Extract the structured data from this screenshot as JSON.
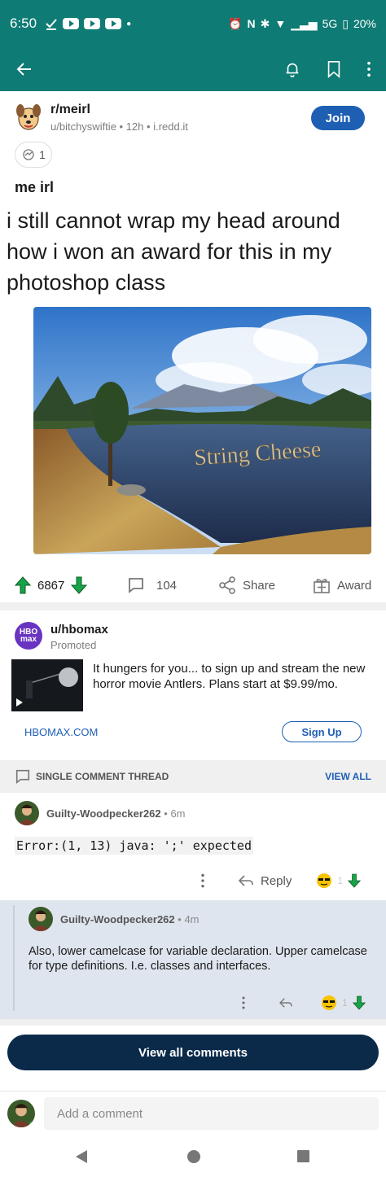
{
  "status_bar": {
    "time": "6:50",
    "network": "5G",
    "battery": "20%"
  },
  "toolbar": {
    "back_icon": "arrow-left-icon",
    "notification_icon": "bell-icon",
    "save_icon": "bookmark-icon",
    "more_icon": "more-vertical-icon"
  },
  "post": {
    "subreddit": "r/meirl",
    "author": "u/bitchyswiftie",
    "age": "12h",
    "domain": "i.redd.it",
    "join_label": "Join",
    "award_count": "1",
    "flair": "me irl",
    "title": "i still cannot wrap my head around how i won an award for this in my photoshop class",
    "image_caption": "String Cheese",
    "upvotes": "6867",
    "comments": "104",
    "share_label": "Share",
    "award_label": "Award"
  },
  "ad": {
    "user": "u/hbomax",
    "logo_text_1": "HBO",
    "logo_text_2": "max",
    "promoted_label": "Promoted",
    "text": "It hungers for you... to sign up and stream the new horror movie Antlers. Plans start at $9.99/mo.",
    "domain": "HBOMAX.COM",
    "cta_label": "Sign Up"
  },
  "thread": {
    "label": "SINGLE COMMENT THREAD",
    "view_all_label": "VIEW ALL"
  },
  "comments": [
    {
      "user": "Guilty-Woodpecker262",
      "age": "6m",
      "body": "Error:(1, 13) java: ';' expected",
      "reply_label": "Reply",
      "score": "1"
    },
    {
      "user": "Guilty-Woodpecker262",
      "age": "4m",
      "body": "Also, lower camelcase for variable declaration. Upper camelcase for type definitions. I.e. classes and interfaces.",
      "score": "1"
    }
  ],
  "view_all_comments_label": "View all comments",
  "add_comment_placeholder": "Add a comment"
}
